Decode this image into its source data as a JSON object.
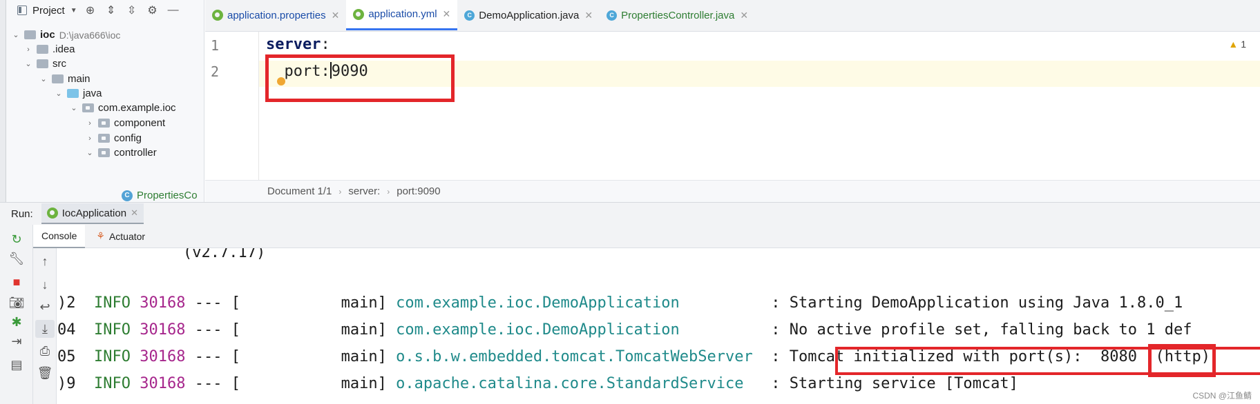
{
  "project": {
    "title": "Project",
    "tree": [
      {
        "label": "ioc",
        "path": "D:\\java666\\ioc"
      },
      {
        "label": ".idea"
      },
      {
        "label": "src"
      },
      {
        "label": "main"
      },
      {
        "label": "java"
      },
      {
        "label": "com.example.ioc"
      },
      {
        "label": "component"
      },
      {
        "label": "config"
      },
      {
        "label": "controller"
      },
      {
        "label": "PropertiesCo"
      }
    ]
  },
  "tabs": [
    {
      "label": "application.properties"
    },
    {
      "label": "application.yml"
    },
    {
      "label": "DemoApplication.java"
    },
    {
      "label": "PropertiesController.java"
    }
  ],
  "editor": {
    "line_numbers": [
      "1",
      "2"
    ],
    "line1_key": "server",
    "line1_colon": ":",
    "line2_key": "port:",
    "line2_value": "9090",
    "warning_count": "1"
  },
  "breadcrumb": [
    "Document 1/1",
    "server:",
    "port:9090"
  ],
  "run": {
    "label": "Run:",
    "config": "IocApplication",
    "subtabs": [
      "Console",
      "Actuator"
    ]
  },
  "console": {
    "banner": "(v2.7.17)",
    "lines": [
      {
        "prefix": ")2",
        "level": "INFO",
        "pid": "30168",
        "sep": "--- [",
        "thread": "main]",
        "logger": "com.example.ioc.DemoApplication",
        "colon": ":",
        "message": "Starting DemoApplication using Java 1.8.0_1"
      },
      {
        "prefix": "04",
        "level": "INFO",
        "pid": "30168",
        "sep": "--- [",
        "thread": "main]",
        "logger": "com.example.ioc.DemoApplication",
        "colon": ":",
        "message": "No active profile set, falling back to 1 def"
      },
      {
        "prefix": "05",
        "level": "INFO",
        "pid": "30168",
        "sep": "--- [",
        "thread": "main]",
        "logger": "o.s.b.w.embedded.tomcat.TomcatWebServer",
        "colon": ":",
        "message": "Tomcat initialized with port(s):",
        "port": "8080",
        "suffix": "(http)"
      },
      {
        "prefix": ")9",
        "level": "INFO",
        "pid": "30168",
        "sep": "--- [",
        "thread": "main]",
        "logger": "o.apache.catalina.core.StandardService",
        "colon": ":",
        "message": "Starting service [Tomcat]"
      }
    ]
  },
  "watermark": "CSDN @江鱼鲭"
}
